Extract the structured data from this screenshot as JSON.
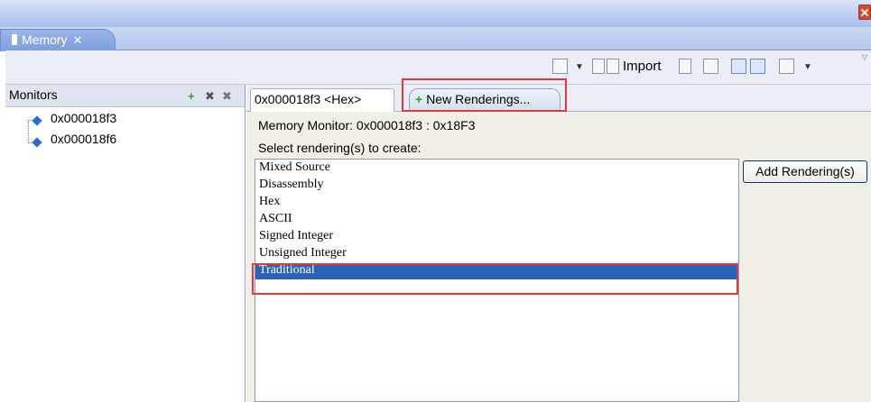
{
  "window": {
    "view_tab_label": "Memory"
  },
  "toolbar": {
    "import_label": "Import"
  },
  "monitors": {
    "header": "Monitors",
    "items": [
      "0x000018f3",
      "0x000018f6"
    ]
  },
  "renderings": {
    "tabs": [
      {
        "label": "0x000018f3 <Hex>"
      },
      {
        "label": "New Renderings..."
      }
    ],
    "monitor_label": "Memory Monitor: 0x000018f3 : 0x18F3",
    "select_prompt": "Select rendering(s) to create:",
    "options": [
      "Mixed Source",
      "Disassembly",
      "Hex",
      "ASCII",
      "Signed Integer",
      "Unsigned Integer",
      "Traditional"
    ],
    "selected": "Traditional",
    "add_button": "Add Rendering(s)"
  },
  "colors": {
    "selection": "#2b63b6",
    "highlight": "#e03a3a"
  }
}
